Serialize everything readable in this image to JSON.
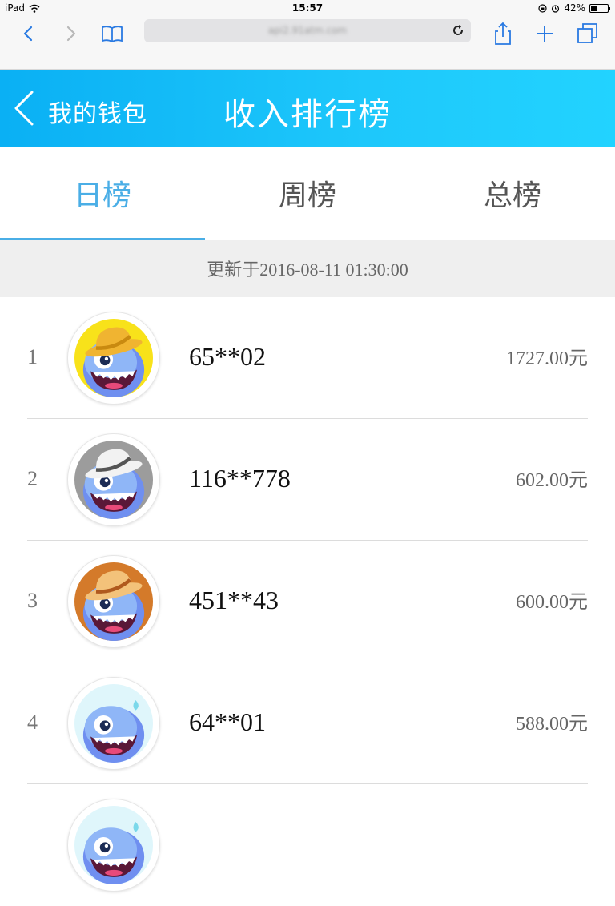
{
  "status_bar": {
    "device": "iPad",
    "time": "15:57",
    "battery": "42%",
    "battery_level": 0.42
  },
  "browser": {
    "url": "api2.91atm.com"
  },
  "header": {
    "back_label": "我的钱包",
    "title": "收入排行榜"
  },
  "tabs": [
    {
      "label": "日榜",
      "active": true
    },
    {
      "label": "周榜",
      "active": false
    },
    {
      "label": "总榜",
      "active": false
    }
  ],
  "update_text": "更新于2016-08-11 01:30:00",
  "rankings": [
    {
      "rank": "1",
      "name": "65**02",
      "amount": "1727.00元",
      "badge_color": "#f8e21a",
      "hat_color": "#f0b431",
      "hat_band": "#c98a10"
    },
    {
      "rank": "2",
      "name": "116**778",
      "amount": "602.00元",
      "badge_color": "#9c9c9c",
      "hat_color": "#f2f2f2",
      "hat_band": "#555555"
    },
    {
      "rank": "3",
      "name": "451**43",
      "amount": "600.00元",
      "badge_color": "#d47a2a",
      "hat_color": "#f3c27a",
      "hat_band": "#b05a1e"
    },
    {
      "rank": "4",
      "name": "64**01",
      "amount": "588.00元",
      "badge_color": "#dff6fb",
      "hat_color": "",
      "hat_band": ""
    }
  ],
  "colors": {
    "accent": "#4aaee6",
    "header_start": "#0ab0f4",
    "header_end": "#22d3ff"
  }
}
